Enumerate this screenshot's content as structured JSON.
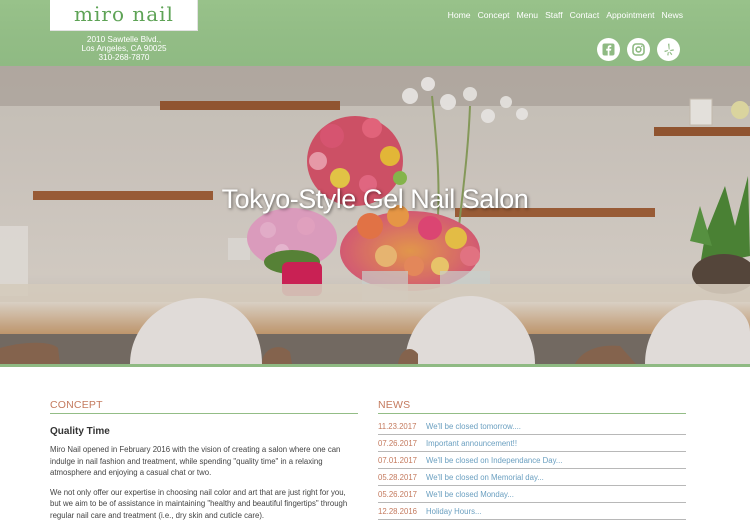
{
  "brand": {
    "logo_text": "miro nail"
  },
  "address": {
    "line1": "2010 Sawtelle Blvd.,",
    "line2": "Los Angeles, CA 90025",
    "phone": "310-268-7870"
  },
  "nav": [
    {
      "label": "Home"
    },
    {
      "label": "Concept"
    },
    {
      "label": "Menu"
    },
    {
      "label": "Staff"
    },
    {
      "label": "Contact"
    },
    {
      "label": "Appointment"
    },
    {
      "label": "News"
    }
  ],
  "social": [
    "facebook-icon",
    "instagram-icon",
    "yelp-icon"
  ],
  "hero": {
    "title": "Tokyo-Style Gel Nail Salon"
  },
  "concept": {
    "heading": "CONCEPT",
    "subheading": "Quality Time",
    "paragraphs": [
      "Miro Nail opened in February 2016 with the vision of creating a salon where one can indulge in nail fashion and treatment, while spending \"quality time\" in a relaxing atmosphere and enjoying a casual chat or two.",
      "We not only offer our expertise in choosing nail color and art that are just right for you, but we aim to be of assistance in maintaining \"healthy and beautiful fingertips\" through regular nail care and treatment (i.e., dry skin and cuticle care)."
    ]
  },
  "news": {
    "heading": "NEWS",
    "items": [
      {
        "date": "11.23.2017",
        "title": "We'll be closed tomorrow...."
      },
      {
        "date": "07.26.2017",
        "title": "Important announcement!!"
      },
      {
        "date": "07.01.2017",
        "title": "We'll be closed on Independance Day..."
      },
      {
        "date": "05.28.2017",
        "title": "We'll be closed on Memorial day..."
      },
      {
        "date": "05.26.2017",
        "title": "We'll be closed Monday..."
      },
      {
        "date": "12.28.2016",
        "title": "Holiday Hours..."
      }
    ]
  },
  "colors": {
    "header_green": "#93bd86",
    "accent_rust": "#c47a5e",
    "link_blue": "#6a9fc0"
  }
}
